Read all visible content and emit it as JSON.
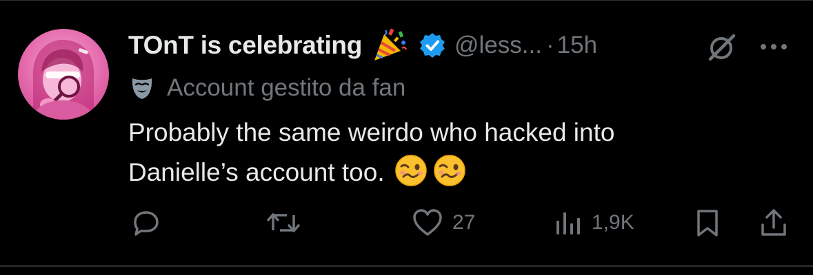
{
  "tweet": {
    "display_name": "TOnT is celebrating",
    "handle": "@less...",
    "separator": "·",
    "time": "15h",
    "fan_label": "Account gestito da fan",
    "text_line1": "Probably the same weirdo who hacked into",
    "text_line2": "Danielle’s account too.",
    "icons": {
      "party": "party-popper-icon",
      "verified": "verified-badge-icon",
      "grok": "grok-icon",
      "more": "more-icon",
      "mask": "theater-mask-icon",
      "emoji": "woozy-face-emoji"
    }
  },
  "actions": {
    "reply_count": "",
    "repost_count": "",
    "like_count": "27",
    "views_count": "1,9K"
  },
  "colors": {
    "background": "#000000",
    "text": "#e7e9ea",
    "muted": "#71767b",
    "verified": "#1d9bf0",
    "avatar_pink": "#e46aad"
  }
}
